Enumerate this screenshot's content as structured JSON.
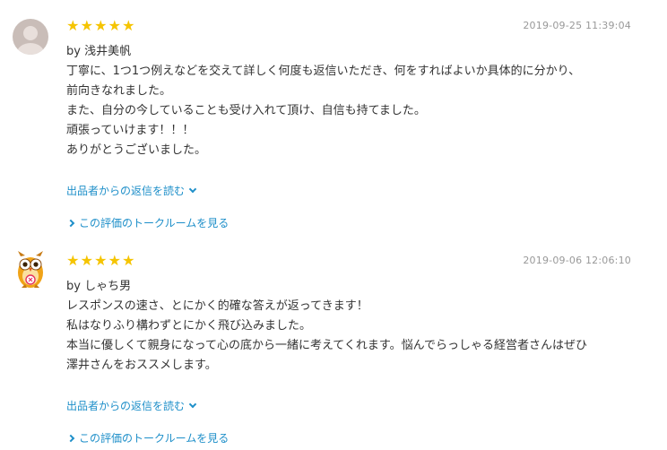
{
  "reviews": [
    {
      "stars": [
        "★",
        "★",
        "★",
        "★",
        "★"
      ],
      "timestamp": "2019-09-25 11:39:04",
      "author": "by 浅井美帆",
      "comment_lines": [
        "丁寧に、1つ1つ例えなどを交えて詳しく何度も返信いただき、何をすればよいか具体的に分かり、",
        "前向きなれました。",
        "また、自分の今していることも受け入れて頂け、自信も持てました。",
        "頑張っていけます！！！",
        "ありがとうございました。"
      ],
      "reply_link": "出品者からの返信を読む",
      "talk_link": "この評価のトークルームを見る"
    },
    {
      "stars": [
        "★",
        "★",
        "★",
        "★",
        "★"
      ],
      "timestamp": "2019-09-06 12:06:10",
      "author": "by しゃち男",
      "comment_lines": [
        "レスポンスの速さ、とにかく的確な答えが返ってきます！",
        "私はなりふり構わずとにかく飛び込みました。",
        "本当に優しくて親身になって心の底から一緒に考えてくれます。悩んでらっしゃる経営者さんはぜひ",
        "澤井さんをおススメします。"
      ],
      "reply_link": "出品者からの返信を読む",
      "talk_link": "この評価のトークルームを見る"
    }
  ],
  "colors": {
    "star": "#f5c400",
    "link": "#1e8fc9",
    "text": "#333333",
    "timestamp": "#999999"
  }
}
